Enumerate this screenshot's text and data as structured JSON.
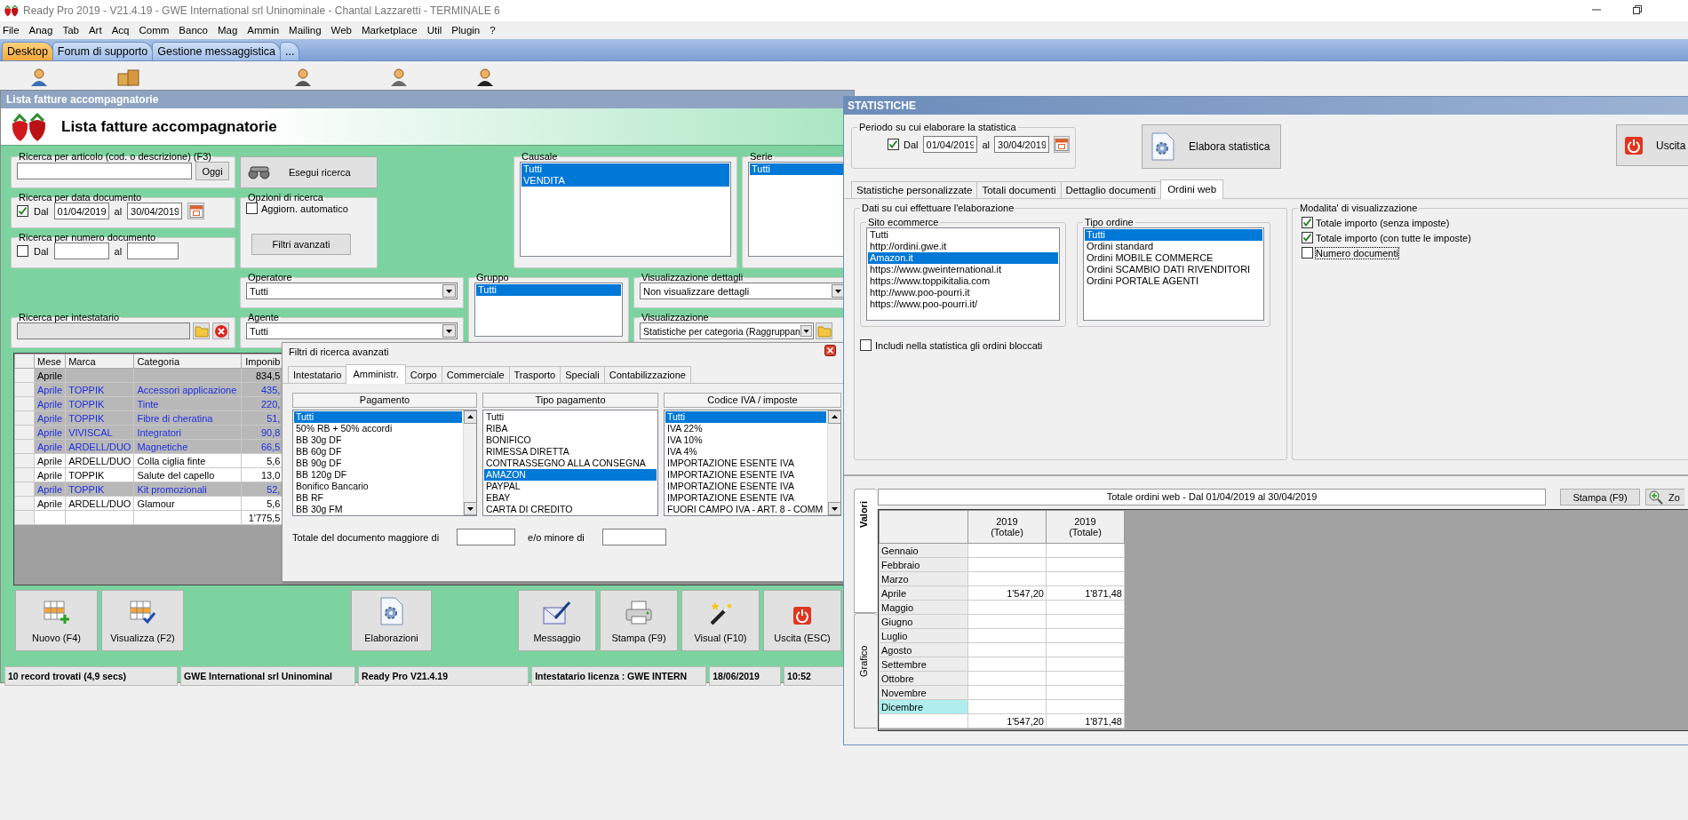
{
  "app": {
    "title": "Ready Pro 2019 - V21.4.19 - GWE International srl Uninominale - Chantal Lazzaretti - TERMINALE 6"
  },
  "menu": [
    "File",
    "Anag",
    "Tab",
    "Art",
    "Acq",
    "Comm",
    "Banco",
    "Mag",
    "Ammin",
    "Mailing",
    "Web",
    "Marketplace",
    "Util",
    "Plugin",
    "?"
  ],
  "tabs": [
    {
      "label": "Desktop",
      "selected": true
    },
    {
      "label": "Forum di supporto",
      "selected": false
    },
    {
      "label": "Gestione messaggistica",
      "selected": false
    },
    {
      "label": "...",
      "selected": false
    }
  ],
  "lista": {
    "window_title": "Lista fatture accompagnatorie",
    "heading": "Lista fatture accompagnatorie",
    "ricerca_articolo": {
      "legend": "Ricerca per articolo (cod. o descrizione) (F3)",
      "button": "Oggi"
    },
    "ricerca_data": {
      "legend": "Ricerca per data documento",
      "checked": true,
      "check_label": "Dal",
      "from": "01/04/2019",
      "to_label": "al",
      "to": "30/04/2019"
    },
    "ricerca_numero": {
      "legend": "Ricerca per numero documento",
      "checked": false,
      "check_label": "Dal",
      "to_label": "al"
    },
    "ricerca_intestatario": {
      "legend": "Ricerca per intestatario"
    },
    "search_button": "Esegui ricerca",
    "opzioni": {
      "legend": "Opzioni di ricerca",
      "checked": false,
      "check_label": "Aggiorn. automatico",
      "button": "Filtri avanzati"
    },
    "causale": {
      "legend": "Causale",
      "items": [
        {
          "label": "Tutti",
          "selected": true
        },
        {
          "label": "VENDITA",
          "selected": true
        }
      ]
    },
    "serie": {
      "legend": "Serie",
      "items": [
        {
          "label": "Tutti",
          "selected": true
        }
      ]
    },
    "operatore": {
      "legend": "Operatore",
      "value": "Tutti"
    },
    "agente": {
      "legend": "Agente",
      "value": "Tutti"
    },
    "gruppo": {
      "legend": "Gruppo",
      "items": [
        {
          "label": "Tutti",
          "selected": true
        }
      ]
    },
    "visualizzazione_dettagli": {
      "legend": "Visualizzazione dettagli",
      "value": "Non visualizzare dettagli"
    },
    "visualizzazione": {
      "legend": "Visualizzazione",
      "value": "Statistiche per categoria (Raggruppan"
    },
    "table": {
      "columns": [
        "Mese",
        "Marca",
        "Categoria",
        "Imponib"
      ],
      "rows": [
        {
          "kind": "group",
          "selected": false,
          "cells": [
            "Aprile",
            "",
            "",
            "834,5"
          ]
        },
        {
          "kind": "item",
          "selected": true,
          "cells": [
            "Aprile",
            "TOPPIK",
            "Accessori applicazione",
            "435,"
          ]
        },
        {
          "kind": "item",
          "selected": true,
          "cells": [
            "Aprile",
            "TOPPIK",
            "Tinte",
            "220,"
          ]
        },
        {
          "kind": "item",
          "selected": true,
          "cells": [
            "Aprile",
            "TOPPIK",
            "Fibre di cheratina",
            "51,"
          ]
        },
        {
          "kind": "item",
          "selected": true,
          "cells": [
            "Aprile",
            "VIVISCAL",
            "Integratori",
            "90,8"
          ]
        },
        {
          "kind": "item",
          "selected": true,
          "cells": [
            "Aprile",
            "ARDELL/DUO",
            "Magnetiche",
            "66,5"
          ]
        },
        {
          "kind": "item",
          "selected": false,
          "cells": [
            "Aprile",
            "ARDELL/DUO",
            "Colla ciglia finte",
            "5,6"
          ]
        },
        {
          "kind": "item",
          "selected": false,
          "cells": [
            "Aprile",
            "TOPPIK",
            "Salute del capello",
            "13,0"
          ]
        },
        {
          "kind": "item",
          "selected": true,
          "cells": [
            "Aprile",
            "TOPPIK",
            "Kit promozionali",
            "52,"
          ]
        },
        {
          "kind": "item",
          "selected": false,
          "cells": [
            "Aprile",
            "ARDELL/DUO",
            "Glamour",
            "5,6"
          ]
        },
        {
          "kind": "total",
          "selected": false,
          "cells": [
            "",
            "",
            "",
            "1'775,5"
          ]
        }
      ]
    },
    "buttons": [
      "Nuovo (F4)",
      "Visualizza (F2)",
      "Elaborazioni",
      "Messaggio",
      "Stampa (F9)",
      "Visual (F10)",
      "Uscita (ESC)"
    ],
    "status_bar": [
      "10 record trovati (4,9 secs)",
      "GWE International srl Uninominal",
      "Ready Pro V21.4.19",
      "Intestatario licenza : GWE INTERN",
      "18/06/2019",
      "10:52"
    ]
  },
  "filters": {
    "title": "Filtri di ricerca avanzati",
    "tabs": [
      {
        "label": "Intestatario",
        "selected": false
      },
      {
        "label": "Amministr.",
        "selected": true
      },
      {
        "label": "Corpo",
        "selected": false
      },
      {
        "label": "Commerciale",
        "selected": false
      },
      {
        "label": "Trasporto",
        "selected": false
      },
      {
        "label": "Speciali",
        "selected": false
      },
      {
        "label": "Contabilizzazione",
        "selected": false
      }
    ],
    "lists": [
      {
        "header": "Pagamento",
        "kind": "scrolling",
        "items": [
          {
            "label": "Tutti",
            "selected": true
          },
          {
            "label": "50% RB + 50% accordi",
            "selected": false
          },
          {
            "label": "BB 30g DF",
            "selected": false
          },
          {
            "label": "BB 60g DF",
            "selected": false
          },
          {
            "label": "BB 90g DF",
            "selected": false
          },
          {
            "label": "BB 120g DF",
            "selected": false
          },
          {
            "label": "Bonifico Bancario",
            "selected": false
          },
          {
            "label": "BB RF",
            "selected": false
          },
          {
            "label": "BB 30g FM",
            "selected": false
          }
        ]
      },
      {
        "header": "Tipo pagamento",
        "kind": "plain",
        "items": [
          {
            "label": "Tutti",
            "selected": false
          },
          {
            "label": "RIBA",
            "selected": false
          },
          {
            "label": "BONIFICO",
            "selected": false
          },
          {
            "label": "RIMESSA DIRETTA",
            "selected": false
          },
          {
            "label": "CONTRASSEGNO ALLA CONSEGNA",
            "selected": false
          },
          {
            "label": "AMAZON",
            "selected": true
          },
          {
            "label": "PAYPAL",
            "selected": false
          },
          {
            "label": "EBAY",
            "selected": false
          },
          {
            "label": "CARTA DI CREDITO",
            "selected": false
          }
        ]
      },
      {
        "header": "Codice IVA / imposte",
        "kind": "scrolling",
        "items": [
          {
            "label": "Tutti",
            "selected": true
          },
          {
            "label": "IVA 22%",
            "selected": false
          },
          {
            "label": "IVA 10%",
            "selected": false
          },
          {
            "label": "IVA 4%",
            "selected": false
          },
          {
            "label": "IMPORTAZIONE ESENTE IVA",
            "selected": false
          },
          {
            "label": "IMPORTAZIONE ESENTE IVA",
            "selected": false
          },
          {
            "label": "IMPORTAZIONE ESENTE IVA",
            "selected": false
          },
          {
            "label": "IMPORTAZIONE ESENTE IVA",
            "selected": false
          },
          {
            "label": "FUORI CAMPO IVA - ART. 8 - COMM",
            "selected": false
          }
        ]
      }
    ],
    "total_label": "Totale del documento maggiore di",
    "or_label": "e/o minore di"
  },
  "statistiche": {
    "window_title": "STATISTICHE",
    "periodo": {
      "legend": "Periodo su cui elaborare la statistica",
      "checked": true,
      "check_label": "Dal",
      "from": "01/04/2019",
      "to_label": "al",
      "to": "30/04/2019"
    },
    "elabora_button": "Elabora statistica",
    "exit_button": "Uscita",
    "tabs": [
      {
        "label": "Statistiche personalizzate",
        "selected": false
      },
      {
        "label": "Totali documenti",
        "selected": false
      },
      {
        "label": "Dettaglio documenti",
        "selected": false
      },
      {
        "label": "Ordini web",
        "selected": true
      }
    ],
    "dati": {
      "legend": "Dati su cui effettuare l'elaborazione",
      "sito": {
        "legend": "Sito ecommerce",
        "items": [
          {
            "label": "Tutti",
            "selected": false
          },
          {
            "label": "http://ordini.gwe.it",
            "selected": false
          },
          {
            "label": "Amazon.it",
            "selected": true
          },
          {
            "label": "https://www.gweinternational.it",
            "selected": false
          },
          {
            "label": "https://www.toppikitalia.com",
            "selected": false
          },
          {
            "label": "http://www.poo-pourri.it",
            "selected": false
          },
          {
            "label": "https://www.poo-pourri.it/",
            "selected": false
          }
        ]
      },
      "tipo": {
        "legend": "Tipo ordine",
        "items": [
          {
            "label": "Tutti",
            "selected": true
          },
          {
            "label": "Ordini standard",
            "selected": false
          },
          {
            "label": "Ordini MOBILE COMMERCE",
            "selected": false
          },
          {
            "label": "Ordini SCAMBIO DATI RIVENDITORI",
            "selected": false
          },
          {
            "label": "Ordini PORTALE AGENTI",
            "selected": false
          }
        ]
      },
      "bloccati": {
        "label": "Includi nella statistica gli ordini bloccati",
        "checked": false
      }
    },
    "modalita": {
      "legend": "Modalita' di visualizzazione",
      "options": [
        {
          "label": "Totale importo (senza imposte)",
          "checked": true,
          "focused": false
        },
        {
          "label": "Totale importo (con tutte le imposte)",
          "checked": true,
          "focused": false
        },
        {
          "label": "Numero documenti",
          "checked": false,
          "focused": true
        }
      ]
    },
    "side_tabs": [
      {
        "label": "Valori",
        "selected": true
      },
      {
        "label": "Grafico",
        "selected": false
      }
    ],
    "result_title": "Totale ordini web - Dal 01/04/2019 al 30/04/2019",
    "print_button": "Stampa (F9)",
    "zoom_button": "Zo",
    "table": {
      "columns": [
        [
          "2019",
          "(Totale)"
        ],
        [
          "2019",
          "(Totale)"
        ]
      ],
      "rows": [
        {
          "label": "Gennaio",
          "selected": false
        },
        {
          "label": "Febbraio",
          "selected": false
        },
        {
          "label": "Marzo",
          "selected": false
        },
        {
          "label": "Aprile",
          "selected": false,
          "values": [
            "1'547,20",
            "1'871,48"
          ]
        },
        {
          "label": "Maggio",
          "selected": false
        },
        {
          "label": "Giugno",
          "selected": false
        },
        {
          "label": "Luglio",
          "selected": false
        },
        {
          "label": "Agosto",
          "selected": false
        },
        {
          "label": "Settembre",
          "selected": false
        },
        {
          "label": "Ottobre",
          "selected": false
        },
        {
          "label": "Novembre",
          "selected": false
        },
        {
          "label": "Dicembre",
          "selected": true
        }
      ],
      "total": [
        "1'547,20",
        "1'871,48"
      ]
    }
  }
}
